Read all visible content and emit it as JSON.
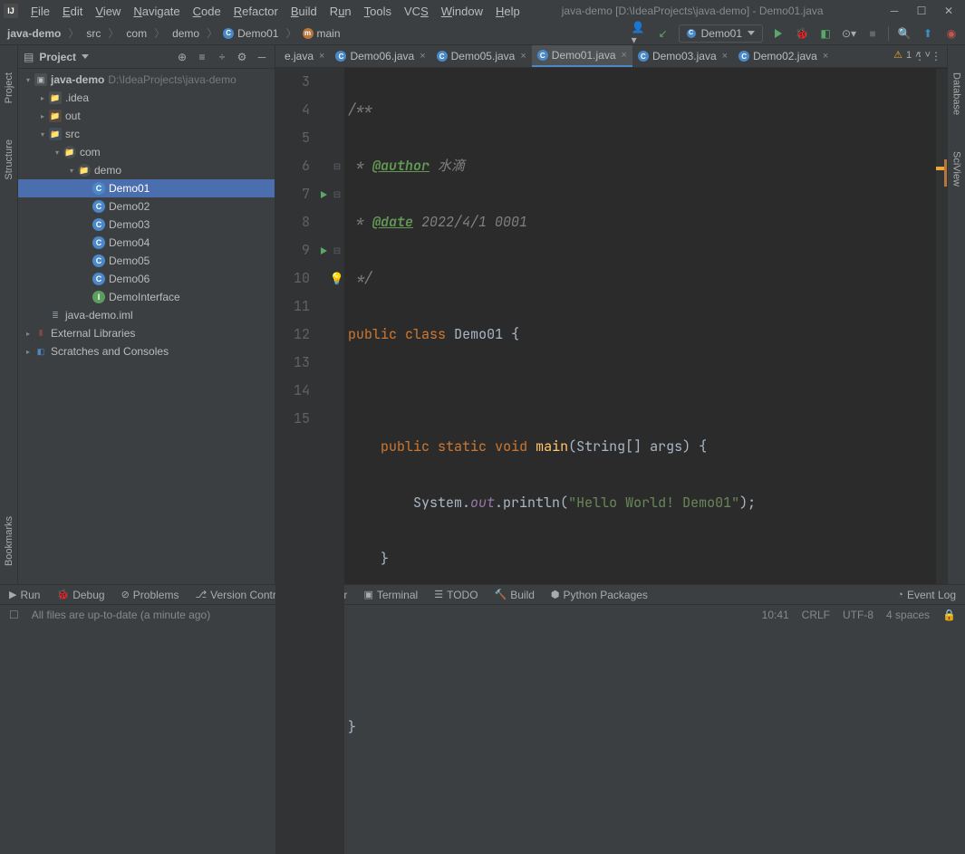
{
  "title": "java-demo [D:\\IdeaProjects\\java-demo] - Demo01.java",
  "menus": [
    "File",
    "Edit",
    "View",
    "Navigate",
    "Code",
    "Refactor",
    "Build",
    "Run",
    "Tools",
    "VCS",
    "Window",
    "Help"
  ],
  "breadcrumb": {
    "project": "java-demo",
    "src": "src",
    "com": "com",
    "demo": "demo",
    "cls": "Demo01",
    "meth": "main"
  },
  "runConfig": "Demo01",
  "projectPanel": {
    "title": "Project",
    "root": {
      "name": "java-demo",
      "path": "D:\\IdeaProjects\\java-demo"
    },
    "idea": ".idea",
    "out": "out",
    "src": "src",
    "com": "com",
    "demo": "demo",
    "classes": [
      "Demo01",
      "Demo02",
      "Demo03",
      "Demo04",
      "Demo05",
      "Demo06"
    ],
    "iface": "DemoInterface",
    "iml": "java-demo.iml",
    "ext": "External Libraries",
    "scratch": "Scratches and Consoles"
  },
  "tabs": [
    {
      "name": "e.java",
      "type": "trunc"
    },
    {
      "name": "Demo06.java"
    },
    {
      "name": "Demo05.java"
    },
    {
      "name": "Demo01.java",
      "active": true
    },
    {
      "name": "Demo03.java"
    },
    {
      "name": "Demo02.java"
    }
  ],
  "code": {
    "lines": [
      "3",
      "4",
      "5",
      "6",
      "7",
      "8",
      "9",
      "10",
      "11",
      "12",
      "13",
      "14",
      "15"
    ],
    "l3": "/**",
    "l4a": " * ",
    "l4b": "@author",
    "l4c": " 水滴",
    "l5a": " * ",
    "l5b": "@date",
    "l5c": " 2022/4/1 0001",
    "l6": " */",
    "l7a": "public",
    "l7b": "class",
    "l7c": "Demo01",
    "l7d": " {",
    "l9a": "public",
    "l9b": "static",
    "l9c": "void",
    "l9d": "main",
    "l9e": "(String[] args) {",
    "l10a": "System.",
    "l10b": "out",
    "l10c": ".println(",
    "l10d": "\"Hello World! Demo01\"",
    "l10e": ");",
    "l11": "    }",
    "l14": "}"
  },
  "warnCount": "1",
  "bottomTools": [
    "Run",
    "Debug",
    "Problems",
    "Version Control",
    "Profiler",
    "Terminal",
    "TODO",
    "Build",
    "Python Packages"
  ],
  "eventLog": "Event Log",
  "statusMsg": "All files are up-to-date (a minute ago)",
  "status": {
    "time": "10:41",
    "le": "CRLF",
    "enc": "UTF-8",
    "indent": "4 spaces"
  },
  "leftTools": [
    "Project",
    "Structure",
    "Bookmarks"
  ],
  "rightTools": [
    "Database",
    "SciView"
  ]
}
